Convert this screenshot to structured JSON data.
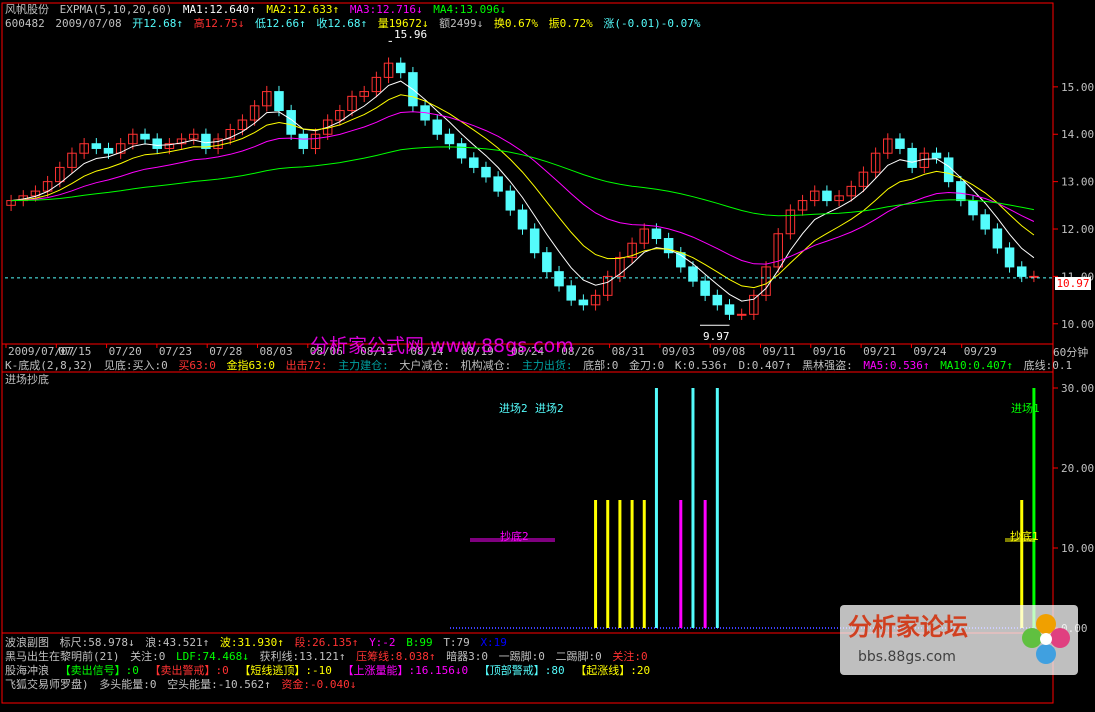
{
  "header": {
    "stock_name": "风帆股份",
    "indicator": "EXPMA(5,10,20,60)",
    "ma1": "MA1:12.640↑",
    "ma2": "MA2:12.633↑",
    "ma3": "MA3:12.716↓",
    "ma4": "MA4:13.096↓",
    "code": "600482",
    "date": "2009/07/08",
    "open": "开12.68↑",
    "high": "高12.75↓",
    "low": "低12.66↑",
    "close": "收12.68↑",
    "volume": "量19672↓",
    "amount": "额2499↓",
    "turnover": "换0.67%",
    "amplitude": "振0.72%",
    "change": "涨(-0.01)-0.07%"
  },
  "watermark": {
    "center": "分析家公式网 www.88gs.com",
    "logo_title": "分析家论坛",
    "logo_url": "bbs.88gs.com"
  },
  "period_label": "60分钟",
  "price_marker": "10.97",
  "annotations": {
    "high_label": "15.96",
    "low_label": "9.97",
    "entry1": "进场1",
    "entry2": "进场2",
    "dip2": "抄底2",
    "dip1": "抄底1"
  },
  "middle_row": {
    "k_label": "K-底成(2,8,32)",
    "jiandi": "见底:买入:0",
    "mai": "买63:0",
    "jinzhi": "金指63:0",
    "chuji": "出击72:",
    "zhuli": "主力建仓:",
    "dahu": "大户减仓:",
    "jigou": "机构减仓:",
    "zhuli2": "主力出货:",
    "dibu": "底部:0",
    "jindao": "金刀:0",
    "k": "K:0.536↑",
    "d": "D:0.407↑",
    "heilin": "黑林强盗:",
    "ma5": "MA5:0.536↑",
    "ma10": "MA10:0.407↑",
    "dixian": "底线:0.1"
  },
  "sub_title": "进场抄底",
  "bottom_rows": {
    "r1": [
      "波浪副图",
      "标尺:58.978↓",
      "浪:43.521↑",
      "波:31.930↑",
      "段:26.135↑",
      "Y:-2",
      "B:99",
      "T:79",
      "X:19"
    ],
    "r2": [
      "黑马出生在黎明前(21)",
      "关注:0",
      "LDF:74.468↓",
      "获利线:13.121↑",
      "压筹线:8.038↑",
      "暗器3:0",
      "一踢脚:0",
      "二踢脚:0",
      "关注:0"
    ],
    "r3": [
      "股海冲浪",
      "【卖出信号】:0",
      "【卖出警戒】:0",
      "【短线逃顶】:-10",
      "【上涨量能】:16.156↓0",
      "【顶部警戒】:80",
      "【起涨线】:20"
    ],
    "r4": [
      "飞狐交易师罗盘)",
      "多头能量:0",
      "空头能量:-10.562↑",
      "资金:-0.040↓"
    ]
  },
  "colors": {
    "bg": "#000000",
    "up": "#ff3232",
    "down": "#54fcfc",
    "ma1": "#ffffff",
    "ma2": "#ffff00",
    "ma3": "#ff00ff",
    "ma4": "#00ff00",
    "axis": "#ff0000"
  },
  "chart_data": [
    {
      "type": "candlestick",
      "title": "",
      "x_tick_labels": [
        "2009/07/07",
        "07/15",
        "07/20",
        "07/23",
        "07/28",
        "08/03",
        "08/06",
        "08/11",
        "08/14",
        "08/19",
        "08/24",
        "08/26",
        "08/31",
        "09/03",
        "09/08",
        "09/11",
        "09/16",
        "09/21",
        "09/24",
        "09/29"
      ],
      "y_tick_labels": [
        "10.00",
        "11.00",
        "12.00",
        "13.00",
        "14.00",
        "15.00"
      ],
      "ylim": [
        9.7,
        16.2
      ],
      "close_series": [
        12.6,
        12.7,
        12.8,
        13.0,
        13.3,
        13.6,
        13.8,
        13.7,
        13.6,
        13.8,
        14.0,
        13.9,
        13.7,
        13.8,
        13.9,
        14.0,
        13.7,
        13.9,
        14.1,
        14.3,
        14.6,
        14.9,
        14.5,
        14.0,
        13.7,
        14.0,
        14.3,
        14.5,
        14.8,
        14.9,
        15.2,
        15.5,
        15.3,
        14.6,
        14.3,
        14.0,
        13.8,
        13.5,
        13.3,
        13.1,
        12.8,
        12.4,
        12.0,
        11.5,
        11.1,
        10.8,
        10.5,
        10.4,
        10.6,
        11.0,
        11.4,
        11.7,
        12.0,
        11.8,
        11.5,
        11.2,
        10.9,
        10.6,
        10.4,
        10.2,
        10.2,
        10.6,
        11.2,
        11.9,
        12.4,
        12.6,
        12.8,
        12.6,
        12.7,
        12.9,
        13.2,
        13.6,
        13.9,
        13.7,
        13.3,
        13.6,
        13.5,
        13.0,
        12.6,
        12.3,
        12.0,
        11.6,
        11.2,
        11.0,
        11.0
      ],
      "series": [
        {
          "name": "MA1",
          "last": 12.64
        },
        {
          "name": "MA2",
          "last": 12.633
        },
        {
          "name": "MA3",
          "last": 12.716
        },
        {
          "name": "MA4",
          "last": 13.096
        }
      ],
      "price_line": 10.97,
      "annotated_high": 15.96,
      "annotated_low": 9.97,
      "grid": false
    },
    {
      "type": "bar",
      "title": "",
      "y_tick_labels": [
        "0.00",
        "10.00",
        "20.00",
        "30.00"
      ],
      "ylim": [
        0,
        30
      ],
      "signal_bars": [
        {
          "x_index": 48,
          "value": 16,
          "color": "#ffff00"
        },
        {
          "x_index": 49,
          "value": 16,
          "color": "#ffff00"
        },
        {
          "x_index": 50,
          "value": 16,
          "color": "#ffff00"
        },
        {
          "x_index": 51,
          "value": 16,
          "color": "#ffff00"
        },
        {
          "x_index": 52,
          "value": 16,
          "color": "#ffff00"
        },
        {
          "x_index": 53,
          "value": 30,
          "color": "#54fcfc"
        },
        {
          "x_index": 55,
          "value": 16,
          "color": "#ff00ff"
        },
        {
          "x_index": 56,
          "value": 30,
          "color": "#54fcfc"
        },
        {
          "x_index": 57,
          "value": 16,
          "color": "#ff00ff"
        },
        {
          "x_index": 58,
          "value": 30,
          "color": "#54fcfc"
        },
        {
          "x_index": 83,
          "value": 16,
          "color": "#ffff00"
        },
        {
          "x_index": 84,
          "value": 30,
          "color": "#00ff00"
        }
      ]
    }
  ]
}
